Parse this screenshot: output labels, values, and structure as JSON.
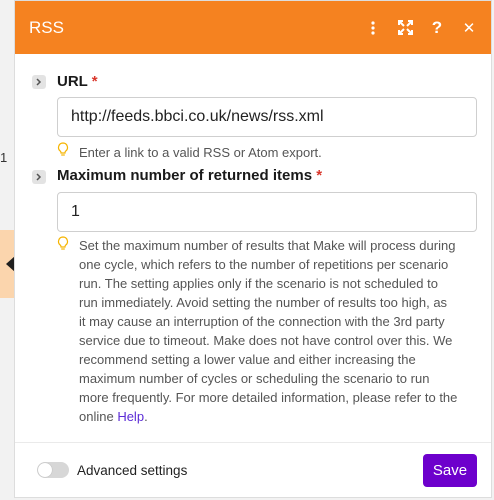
{
  "background": {
    "node_number": "1"
  },
  "dialog": {
    "title": "RSS",
    "header_color": "#f58220",
    "header_icons": [
      "more-vertical-icon",
      "expand-icon",
      "help-icon",
      "close-icon"
    ],
    "header_labels": {
      "help": "?",
      "close": "✕"
    }
  },
  "url_field": {
    "label": "URL",
    "required_mark": "*",
    "value": "http://feeds.bbci.co.uk/news/rss.xml",
    "hint": "Enter a link to a valid RSS or Atom export."
  },
  "max_items_field": {
    "label": "Maximum number of returned items",
    "required_mark": "*",
    "value": "1",
    "hint_lines": [
      "Set the maximum number of results that Make will process during",
      "one cycle, which refers to the number of repetitions per scenario",
      "run. The setting applies only if the scenario is not scheduled to",
      "run immediately. Avoid setting the number of results too high, as",
      "it may cause an interruption of the connection with the 3rd party",
      "service due to timeout. Make does not have control over this. We",
      "recommend setting a lower value and either increasing the",
      "maximum number of cycles or scheduling the scenario to run",
      "more frequently. For more detailed information, please refer to the"
    ],
    "hint_last_prefix": "online ",
    "hint_link": "Help",
    "hint_last_suffix": "."
  },
  "footer": {
    "advanced_label": "Advanced settings",
    "advanced_on": false,
    "save_label": "Save",
    "save_color": "#6d00cc"
  }
}
